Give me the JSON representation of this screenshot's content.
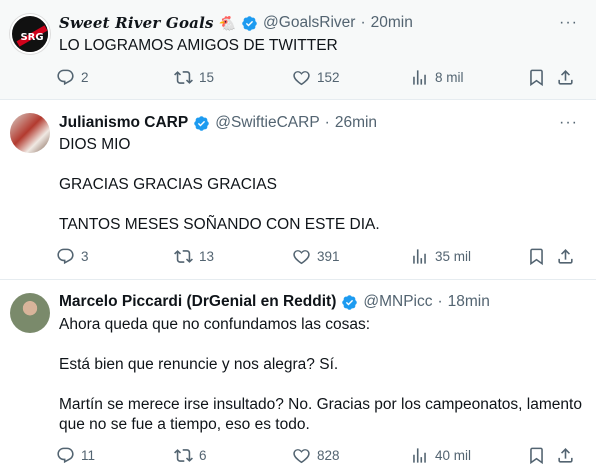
{
  "tweets": [
    {
      "author": "Sweet River Goals",
      "emoji": "🐔",
      "handle": "@GoalsRiver",
      "time": "20min",
      "text": "LO LOGRAMOS AMIGOS DE TWITTER",
      "replies": "2",
      "retweets": "15",
      "likes": "152",
      "views": "8 mil"
    },
    {
      "author": "Julianismo CARP",
      "handle": "@SwiftieCARP",
      "time": "26min",
      "text": "DIOS MIO\n\nGRACIAS GRACIAS GRACIAS\n\nTANTOS MESES SOÑANDO CON ESTE DIA.",
      "replies": "3",
      "retweets": "13",
      "likes": "391",
      "views": "35 mil"
    },
    {
      "author": "Marcelo Piccardi (DrGenial en Reddit)",
      "handle": "@MNPicc",
      "time": "18min",
      "text": "Ahora queda que no confundamos las cosas:\n\nEstá bien que renuncie y nos alegra? Sí.\n\nMartín se merece irse insultado? No. Gracias por los campeonatos, lamento que no se fue a tiempo, eso es todo.",
      "replies": "11",
      "retweets": "6",
      "likes": "828",
      "views": "40 mil"
    }
  ],
  "separator": "·",
  "more_glyph": "···"
}
